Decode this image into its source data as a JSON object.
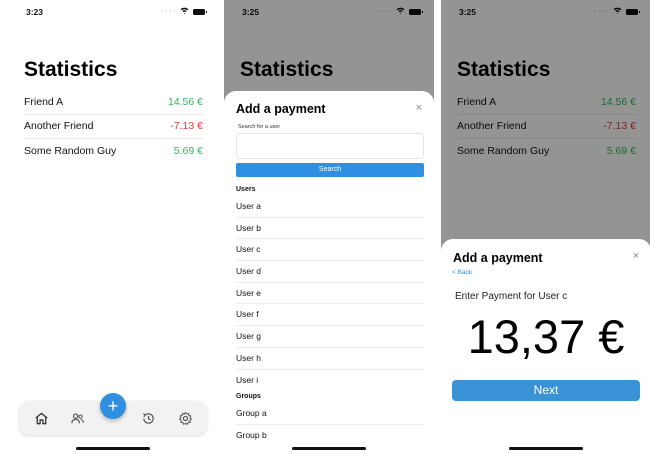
{
  "status": {
    "time_1": "3:23",
    "time_2": "3:25",
    "time_3": "3:25"
  },
  "statistics": {
    "title": "Statistics",
    "friends": [
      {
        "name": "Friend A",
        "amount": "14.56 €",
        "sign": "positive"
      },
      {
        "name": "Another Friend",
        "amount": "-7.13 €",
        "sign": "negative"
      },
      {
        "name": "Some Random Guy",
        "amount": "5.69 €",
        "sign": "positive"
      }
    ]
  },
  "tabbar": {
    "items": [
      "home-icon",
      "users-icon",
      "history-icon",
      "gear-icon"
    ],
    "fab_label": "+"
  },
  "add_payment": {
    "title": "Add a payment",
    "close_label": "×",
    "search_label": "Search for a user",
    "search_placeholder": "",
    "search_button": "Search",
    "users_header": "Users",
    "users": [
      "User a",
      "User b",
      "User c",
      "User d",
      "User e",
      "User f",
      "User g",
      "User h",
      "User i"
    ],
    "groups_header": "Groups",
    "groups": [
      "Group a",
      "Group b"
    ]
  },
  "enter_payment": {
    "title": "Add a payment",
    "close_label": "×",
    "back_label": "< Back",
    "prompt": "Enter Payment for User c",
    "amount": "13,37 €",
    "next_button": "Next"
  },
  "colors": {
    "accent": "#2f8fe0",
    "positive": "#2dbb59",
    "negative": "#e0393e"
  }
}
